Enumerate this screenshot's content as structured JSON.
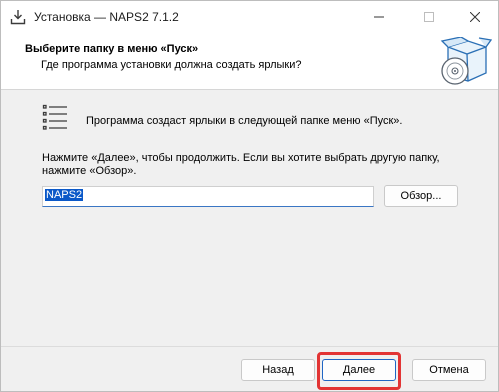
{
  "window": {
    "title": "Установка — NAPS2 7.1.2"
  },
  "header": {
    "title": "Выберите папку в меню «Пуск»",
    "subtitle": "Где программа установки должна создать ярлыки?"
  },
  "body": {
    "info": "Программа создаст ярлыки в следующей папке меню «Пуск».",
    "instruction_line1": "Нажмите «Далее», чтобы продолжить. Если вы хотите выбрать другую папку,",
    "instruction_line2": "нажмите «Обзор».",
    "folder_value": "NAPS2",
    "browse_label": "Обзор..."
  },
  "footer": {
    "back_label": "Назад",
    "next_label": "Далее",
    "cancel_label": "Отмена"
  },
  "colors": {
    "highlight": "#e23434",
    "selection": "#0a58c8"
  },
  "icons": {
    "app": "installer-download-icon",
    "header": "box-disc-icon",
    "list": "list-icon"
  }
}
